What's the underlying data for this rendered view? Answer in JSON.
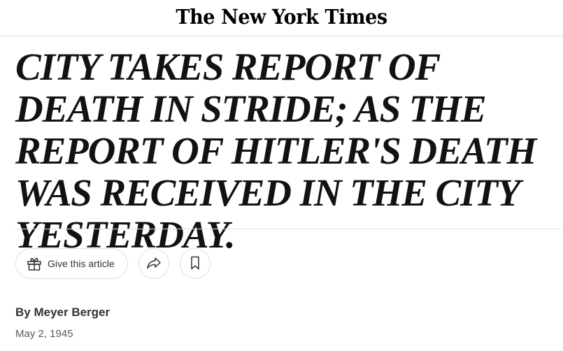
{
  "masthead": {
    "logo_text": "The New York Times"
  },
  "article": {
    "headline": "CITY TAKES REPORT OF DEATH IN STRIDE; AS THE REPORT OF HITLER'S DEATH WAS RECEIVED IN THE CITY YESTERDAY.",
    "byline": "By Meyer Berger",
    "date": "May 2, 1945"
  },
  "share_tools": {
    "gift_label": "Give this article",
    "gift_icon": "gift-icon",
    "share_icon": "share-arrow-icon",
    "save_icon": "bookmark-icon"
  },
  "colors": {
    "text": "#121212",
    "secondary_text": "#5a5a5a",
    "border": "#dfdfdf",
    "divider": "#e2e2e2",
    "background": "#ffffff"
  }
}
